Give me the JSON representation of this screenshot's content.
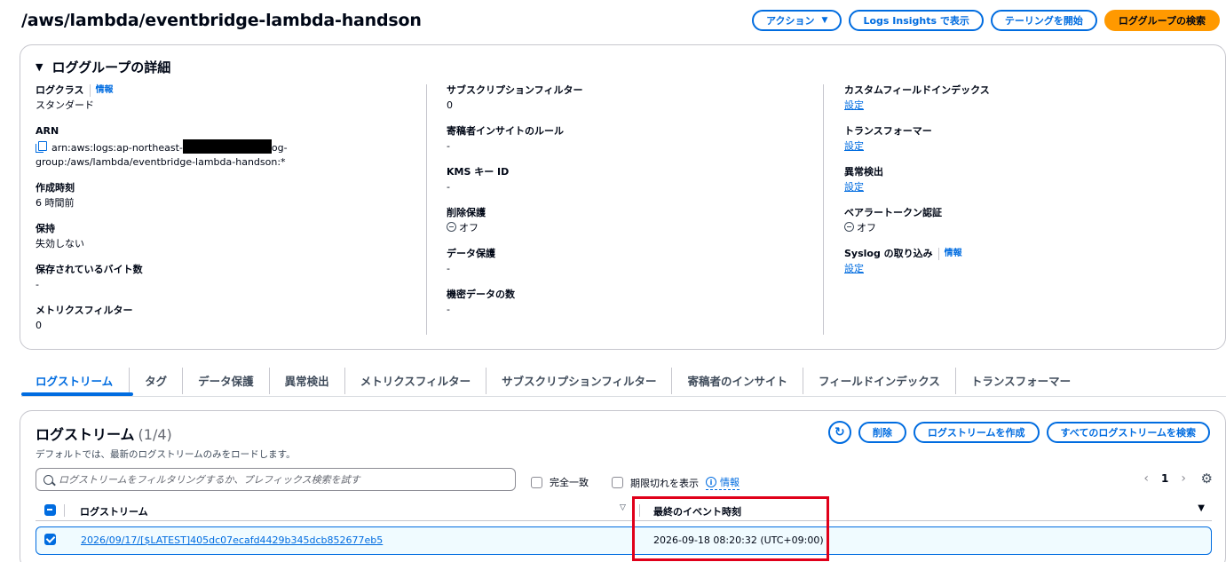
{
  "header": {
    "title": "/aws/lambda/eventbridge-lambda-handson",
    "actions_label": "アクション",
    "logs_insights_label": "Logs Insights で表示",
    "tailing_label": "テーリングを開始",
    "search_label": "ロググループの検索"
  },
  "details": {
    "title": "ロググループの詳細",
    "info_label": "情報",
    "col1": {
      "log_class_label": "ログクラス",
      "log_class_value": "スタンダード",
      "arn_label": "ARN",
      "arn_part1": "arn:aws:logs:ap-northeast-",
      "arn_part2": "og-",
      "arn_part3": "group:/aws/lambda/eventbridge-lambda-handson:*",
      "created_label": "作成時刻",
      "created_value": "6 時間前",
      "retention_label": "保持",
      "retention_value": "失効しない",
      "stored_bytes_label": "保存されているバイト数",
      "stored_bytes_value": "-",
      "metric_filter_label": "メトリクスフィルター",
      "metric_filter_value": "0"
    },
    "col2": {
      "subscription_label": "サブスクリプションフィルター",
      "subscription_value": "0",
      "contributor_label": "寄稿者インサイトのルール",
      "contributor_value": "-",
      "kms_label": "KMS キー ID",
      "kms_value": "-",
      "deletion_label": "削除保護",
      "deletion_value": "オフ",
      "data_protection_label": "データ保護",
      "data_protection_value": "-",
      "sensitive_label": "機密データの数",
      "sensitive_value": "-"
    },
    "col3": {
      "custom_index_label": "カスタムフィールドインデックス",
      "custom_index_value": "設定",
      "transformer_label": "トランスフォーマー",
      "transformer_value": "設定",
      "anomaly_label": "異常検出",
      "anomaly_value": "設定",
      "bearer_label": "ベアラートークン認証",
      "bearer_value": "オフ",
      "syslog_label": "Syslog の取り込み",
      "syslog_value": "設定"
    }
  },
  "tabs": [
    {
      "label": "ログストリーム"
    },
    {
      "label": "タグ"
    },
    {
      "label": "データ保護"
    },
    {
      "label": "異常検出"
    },
    {
      "label": "メトリクスフィルター"
    },
    {
      "label": "サブスクリプションフィルター"
    },
    {
      "label": "寄稿者のインサイト"
    },
    {
      "label": "フィールドインデックス"
    },
    {
      "label": "トランスフォーマー"
    }
  ],
  "streams": {
    "title": "ログストリーム",
    "count": "(1/4)",
    "description": "デフォルトでは、最新のログストリームのみをロードします。",
    "delete_label": "削除",
    "create_label": "ログストリームを作成",
    "search_all_label": "すべてのログストリームを検索",
    "search_placeholder": "ログストリームをフィルタリングするか、プレフィックス検索を試す",
    "exact_match_label": "完全一致",
    "show_expired_label": "期限切れを表示",
    "info_label": "情報",
    "page_number": "1",
    "columns": {
      "name": "ログストリーム",
      "last_event": "最終のイベント時刻"
    },
    "rows": [
      {
        "name": "2026/09/17/[$LATEST]405dc07ecafd4429b345dcb852677eb5",
        "last_event": "2026-09-18 08:20:32 (UTC+09:00)"
      }
    ]
  },
  "colors": {
    "link": "#006ce0",
    "primary_button": "#ff9900",
    "highlight": "#e0001a"
  }
}
